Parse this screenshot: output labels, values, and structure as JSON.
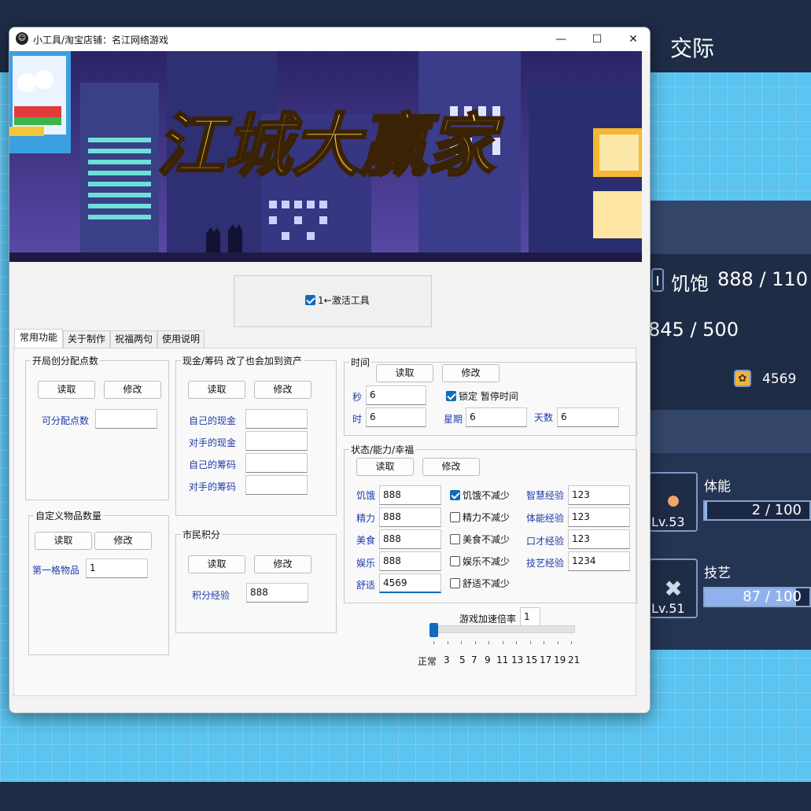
{
  "game": {
    "tab_title": "交际",
    "hunger_label": "饥饱",
    "hunger_value": "888 / 110",
    "second_value": "845 / 500",
    "coin_value": "4569",
    "skills": [
      {
        "name": "体能",
        "level": "Lv.53",
        "progress": "2 / 100",
        "fill": 0.02
      },
      {
        "name": "技艺",
        "level": "Lv.51",
        "progress": "87 / 100",
        "fill": 0.87
      }
    ]
  },
  "window": {
    "title": "小工具/淘宝店铺：名江网络游戏",
    "banner_title": "江城大赢家",
    "activate_label": "1←激活工具",
    "activate_checked": true
  },
  "tabs": [
    "常用功能",
    "关于制作",
    "祝福两句",
    "使用说明"
  ],
  "buttons": {
    "read": "读取",
    "modify": "修改"
  },
  "initial_points": {
    "title": "开局创分配点数",
    "label": "可分配点数",
    "value": ""
  },
  "cash": {
    "title": "现金/筹码 改了也会加到资产",
    "fields": [
      {
        "label": "自己的现金",
        "value": ""
      },
      {
        "label": "对手的现金",
        "value": ""
      },
      {
        "label": "自己的筹码",
        "value": ""
      },
      {
        "label": "对手的筹码",
        "value": ""
      }
    ]
  },
  "custom_items": {
    "title": "自定义物品数量",
    "label": "第一格物品",
    "value": "1"
  },
  "citizen": {
    "title": "市民积分",
    "label": "积分经验",
    "value": "888"
  },
  "time": {
    "title": "时间",
    "second_label": "秒",
    "second_value": "6",
    "lock_label": "锁定 暂停时间",
    "lock_checked": true,
    "hour_label": "时",
    "hour_value": "6",
    "week_label": "星期",
    "week_value": "6",
    "days_label": "天数",
    "days_value": "6"
  },
  "status": {
    "title": "状态/能力/幸福",
    "rows": [
      {
        "label": "饥饿",
        "value": "888",
        "check": "饥饿不减少",
        "checked": true,
        "exp_label": "智慧经验",
        "exp_value": "123"
      },
      {
        "label": "精力",
        "value": "888",
        "check": "精力不减少",
        "checked": false,
        "exp_label": "体能经验",
        "exp_value": "123"
      },
      {
        "label": "美食",
        "value": "888",
        "check": "美食不减少",
        "checked": false,
        "exp_label": "口才经验",
        "exp_value": "123"
      },
      {
        "label": "娱乐",
        "value": "888",
        "check": "娱乐不减少",
        "checked": false,
        "exp_label": "技艺经验",
        "exp_value": "1234"
      },
      {
        "label": "舒适",
        "value": "4569",
        "check": "舒适不减少",
        "checked": false
      }
    ]
  },
  "speed": {
    "label": "游戏加速倍率",
    "value": "1",
    "ticks": [
      "正常",
      "3",
      "5",
      "7",
      "9",
      "11",
      "13",
      "15",
      "17",
      "19",
      "21"
    ],
    "position": 0
  }
}
